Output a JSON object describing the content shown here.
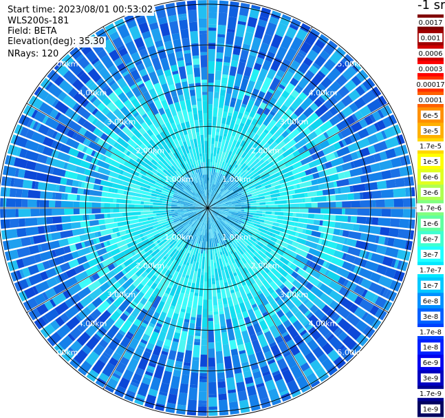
{
  "header": {
    "start_time": "Start time: 2023/08/01 00:53:02",
    "instrument": "WLS200s-181",
    "field": "Field: BETA",
    "elevation": "Elevation(deg): 35.30",
    "nrays": "NRays: 120"
  },
  "colorbar": {
    "unit_label": "-1 sr",
    "ticks": [
      "0.0017",
      "0.001",
      "0.0006",
      "0.0003",
      "0.00017",
      "0.0001",
      "6e-5",
      "3e-5",
      "1.7e-5",
      "1e-5",
      "6e-6",
      "3e-6",
      "1.7e-6",
      "1e-6",
      "6e-7",
      "3e-7",
      "1.7e-7",
      "1e-7",
      "6e-8",
      "3e-8",
      "1.7e-8",
      "1e-8",
      "6e-9",
      "3e-9",
      "1.7e-9",
      "1e-9"
    ],
    "colors": [
      "#800000",
      "#a00000",
      "#d00000",
      "#ff0000",
      "#ff3000",
      "#ff6000",
      "#ff9000",
      "#ffb000",
      "#ffd800",
      "#ffff00",
      "#e0ff20",
      "#b0ff50",
      "#80ff80",
      "#60ffa0",
      "#40ffd0",
      "#20ffff",
      "#00e8ff",
      "#00c8ff",
      "#0090ff",
      "#0060ff",
      "#0040ff",
      "#0020ff",
      "#0000ee",
      "#0000c0",
      "#000090",
      "#000060"
    ]
  },
  "chart_data": {
    "type": "heatmap",
    "projection": "polar-ppi",
    "field": "BETA",
    "nrays": 120,
    "range_rings_km": [
      1,
      2,
      3,
      4,
      5
    ],
    "ring_labels": [
      "1.00km",
      "2.00km",
      "3.00km",
      "4.00km",
      "5.00km"
    ],
    "max_range_km": 5.1,
    "spokes_deg": [
      0,
      30,
      60,
      90,
      120,
      150,
      180,
      210,
      240,
      270,
      300,
      330
    ],
    "value_profile": [
      {
        "range_km": 0.5,
        "typical_value": "1e-8"
      },
      {
        "range_km": 1.5,
        "typical_value": "1.7e-7"
      },
      {
        "range_km": 2.5,
        "typical_value": "1.7e-7"
      },
      {
        "range_km": 3.5,
        "typical_value": "6e-8"
      },
      {
        "range_km": 4.5,
        "typical_value": "3e-8"
      }
    ]
  }
}
